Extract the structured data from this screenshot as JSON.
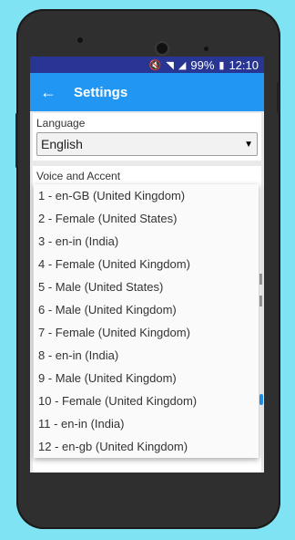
{
  "status_bar": {
    "battery_text": "99%",
    "time": "12:10"
  },
  "app_bar": {
    "title": "Settings",
    "back_icon": "arrow-back-icon"
  },
  "language": {
    "label": "Language",
    "value": "English"
  },
  "voice": {
    "label": "Voice and Accent"
  },
  "voice_options": [
    "1 - en-GB (United Kingdom)",
    "2 - Female (United States)",
    "3 - en-in (India)",
    "4 - Female (United Kingdom)",
    "5 - Male (United States)",
    "6 - Male (United Kingdom)",
    "7 - Female (United Kingdom)",
    "8 - en-in (India)",
    "9 - Male (United Kingdom)",
    "10 - Female (United Kingdom)",
    "11 - en-in (India)",
    "12 - en-gb (United Kingdom)"
  ],
  "colors": {
    "status_bar": "#283593",
    "app_bar": "#2196f3",
    "background": "#7fe3f3"
  }
}
